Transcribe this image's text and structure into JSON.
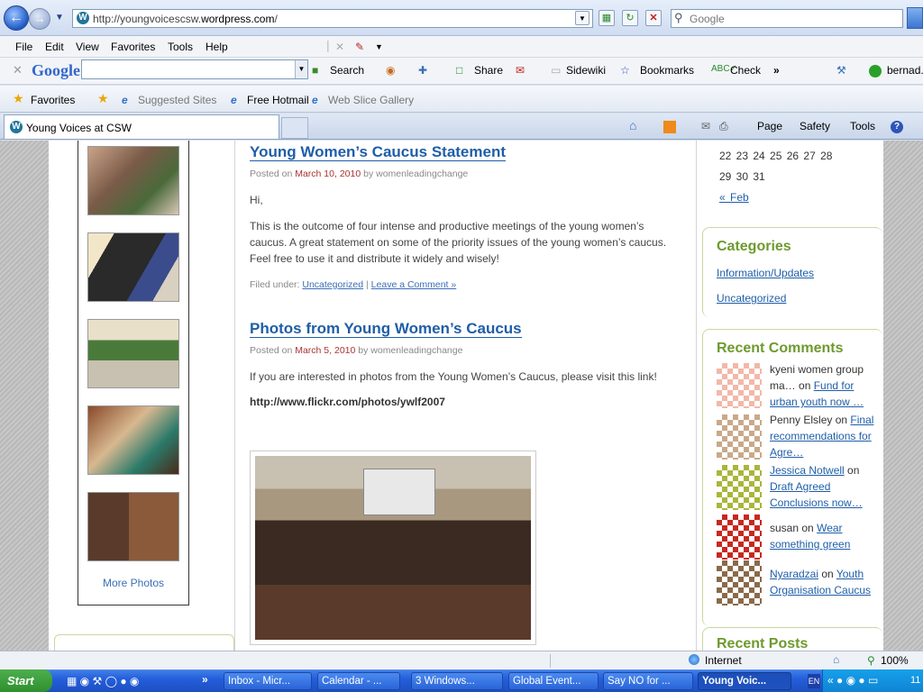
{
  "browser": {
    "url_prefix": "http://youngvoicescsw.",
    "url_domain": "wordpress.com",
    "url_suffix": "/",
    "search_placeholder": "Google",
    "menu": [
      "File",
      "Edit",
      "View",
      "Favorites",
      "Tools",
      "Help"
    ],
    "google_toolbar": {
      "logo": "Google",
      "search_label": "Search",
      "share_label": "Share",
      "sidewiki_label": "Sidewiki",
      "bookmarks_label": "Bookmarks",
      "check_label": "Check",
      "more": "»",
      "user": "bernad."
    },
    "favorites_bar": {
      "favorites_label": "Favorites",
      "suggested_sites": "Suggested Sites",
      "free_hotmail": "Free Hotmail",
      "web_slice_gallery": "Web Slice Gallery"
    },
    "tab_title": "Young Voices at CSW",
    "command_bar": {
      "page": "Page",
      "safety": "Safety",
      "tools": "Tools"
    },
    "status": {
      "zone": "Internet",
      "zoom": "100%"
    }
  },
  "sidebar_left": {
    "more_photos": "More Photos"
  },
  "posts": [
    {
      "title": "Young Women’s Caucus Statement",
      "posted_on": "Posted on",
      "date": "March 10, 2010",
      "by": "by womenleadingchange",
      "greeting": "Hi,",
      "body": "This is the outcome of four intense and productive meetings of the young women’s caucus. A great statement on some of the priority issues of the young women’s caucus. Feel free to use it and distribute it widely and wisely!",
      "filed_under": "Filed under:",
      "category": "Uncategorized",
      "sep": "|",
      "comment_link": "Leave a Comment »"
    },
    {
      "title": "Photos from Young Women’s Caucus",
      "posted_on": "Posted on",
      "date": "March 5, 2010",
      "by": "by womenleadingchange",
      "body": "If you are interested in photos from the Young Women’s Caucus, please visit this link!",
      "link": "http://www.flickr.com/photos/ywlf2007"
    }
  ],
  "sidebar_right": {
    "calendar_row1": "22 23 24 25 26 27 28",
    "calendar_row2": "29 30 31",
    "prev_month": "« Feb",
    "categories_title": "Categories",
    "categories": [
      "Information/Updates",
      "Uncategorized"
    ],
    "recent_comments_title": "Recent Comments",
    "comments": [
      {
        "author": "kyeni women group ma…",
        "on": "on",
        "post": "Fund for urban youth now …",
        "color": "#f2b8a8"
      },
      {
        "author": "Penny Elsley",
        "on": "on",
        "post": "Final recommendations for Agre…",
        "color": "#c9a98a"
      },
      {
        "author": "Jessica Notwell",
        "on": "on",
        "post": "Draft Agreed Conclusions now…",
        "color": "#a9b63a"
      },
      {
        "author": "susan",
        "on": "on",
        "post": "Wear something green",
        "color": "#c8281e"
      },
      {
        "author": "Nyaradzai",
        "on": "on",
        "post": "Youth Organisation Caucus",
        "color": "#8a6a4a"
      }
    ],
    "recent_posts_title": "Recent Posts"
  },
  "taskbar": {
    "start": "Start",
    "tasks": [
      "Inbox - Micr...",
      "Calendar - ...",
      "3 Windows...",
      "Global Event...",
      "Say NO for ...",
      "Young Voic..."
    ],
    "lang": "EN",
    "clock": "11"
  }
}
